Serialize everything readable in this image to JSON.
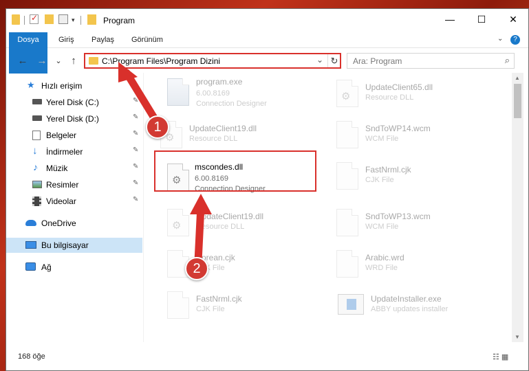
{
  "window": {
    "title": "Program",
    "controls": {
      "minimize": "—",
      "maximize": "☐",
      "close": "✕"
    }
  },
  "ribbon": {
    "tabs": [
      "Dosya",
      "Giriş",
      "Paylaş",
      "Görünüm"
    ],
    "collapse_icon": "chevron-down-icon",
    "help_icon": "?"
  },
  "nav": {
    "back": "←",
    "forward": "→",
    "recent": "⌄",
    "up": "↑"
  },
  "address": {
    "path": "C:\\Program Files\\Program Dizini",
    "refresh": "↻",
    "chevron": "⌄"
  },
  "search": {
    "placeholder": "Ara: Program",
    "icon": "⌕"
  },
  "sidebar": {
    "items": [
      {
        "label": "Hızlı erişim",
        "icon": "star-icon",
        "pinned": false
      },
      {
        "label": "Yerel Disk (C:)",
        "icon": "drive-icon",
        "pinned": true
      },
      {
        "label": "Yerel Disk (D:)",
        "icon": "drive-icon",
        "pinned": true
      },
      {
        "label": "Belgeler",
        "icon": "documents-icon",
        "pinned": true
      },
      {
        "label": "İndirmeler",
        "icon": "download-icon",
        "pinned": true
      },
      {
        "label": "Müzik",
        "icon": "music-icon",
        "pinned": true
      },
      {
        "label": "Resimler",
        "icon": "pictures-icon",
        "pinned": true
      },
      {
        "label": "Videolar",
        "icon": "video-icon",
        "pinned": true
      },
      {
        "label": "OneDrive",
        "icon": "cloud-icon",
        "pinned": false
      },
      {
        "label": "Bu bilgisayar",
        "icon": "computer-icon",
        "pinned": false,
        "selected": true
      },
      {
        "label": "Ağ",
        "icon": "network-icon",
        "pinned": false
      }
    ],
    "pin_glyph": "📌"
  },
  "files": {
    "left": [
      {
        "name": "program.exe",
        "version": "6.00.8169",
        "description": "Connection Designer",
        "icon": "exe-icon"
      },
      {
        "name": "UpdateClient19.dll",
        "version": "",
        "description": "Resource DLL",
        "icon": "gear-file-icon"
      },
      {
        "name": "mscondes.dll",
        "version": "6.00.8169",
        "description": "Connection Designer",
        "icon": "gear-file-icon",
        "highlighted": true
      },
      {
        "name": "UpdateClient19.dll",
        "version": "",
        "description": "Resource DLL",
        "icon": "gear-file-icon"
      },
      {
        "name": "Korean.cjk",
        "version": "",
        "description": "CJK File",
        "icon": "blank-file-icon"
      },
      {
        "name": "FastNrml.cjk",
        "version": "",
        "description": "CJK File",
        "icon": "blank-file-icon"
      }
    ],
    "right": [
      {
        "name": "UpdateClient65.dll",
        "version": "",
        "description": "Resource DLL",
        "icon": "gear-file-icon"
      },
      {
        "name": "SndToWP14.wcm",
        "version": "",
        "description": "WCM File",
        "icon": "blank-file-icon"
      },
      {
        "name": "FastNrml.cjk",
        "version": "",
        "description": "CJK File",
        "icon": "blank-file-icon"
      },
      {
        "name": "SndToWP13.wcm",
        "version": "",
        "description": "WCM File",
        "icon": "blank-file-icon"
      },
      {
        "name": "Arabic.wrd",
        "version": "",
        "description": "WRD File",
        "icon": "blank-file-icon"
      },
      {
        "name": "UpdateInstaller.exe",
        "version": "",
        "description": "ABBY updates installer",
        "icon": "installer-icon"
      }
    ]
  },
  "status": {
    "count": "168 öğe",
    "view_icons": "☷ ▦"
  },
  "callouts": [
    "1",
    "2"
  ]
}
